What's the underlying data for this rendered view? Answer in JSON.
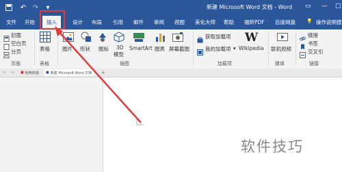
{
  "window": {
    "title": "新建 Microsoft Word 文档 - Word",
    "controls": {
      "minimize": "—",
      "maximize": "□",
      "close": "✕"
    }
  },
  "quick_access": {
    "save_icon": "save-icon",
    "undo_icon": "undo-icon",
    "redo_icon": "redo-icon"
  },
  "tabs": [
    {
      "label": "文件"
    },
    {
      "label": "开始"
    },
    {
      "label": "插入"
    },
    {
      "label": "设计"
    },
    {
      "label": "布局"
    },
    {
      "label": "引用"
    },
    {
      "label": "邮件"
    },
    {
      "label": "审阅"
    },
    {
      "label": "视图"
    },
    {
      "label": "美化大师"
    },
    {
      "label": "帮助"
    },
    {
      "label": "福昕PDF"
    },
    {
      "label": "百度网盘"
    },
    {
      "label": "操作说明搜"
    }
  ],
  "ribbon": {
    "pages": {
      "cover": "封面",
      "blank": "空白页",
      "break": "分页",
      "group": "页面"
    },
    "tables": {
      "table": "表格",
      "group": "表格"
    },
    "illustrations": {
      "pictures": "图片",
      "shapes": "形状",
      "icons": "图标",
      "model_3d_line1": "3D",
      "model_3d_line2": "模型",
      "smartart": "SmartArt",
      "chart": "图表",
      "screenshot": "屏幕截图",
      "group": "插图"
    },
    "addins": {
      "get": "获取加载项",
      "my": "我的加载项",
      "wikipedia": "Wikipedia",
      "group": "加载项"
    },
    "media": {
      "video": "联机视频",
      "group": "媒体"
    },
    "links": {
      "link": "链接",
      "bookmark": "书签",
      "crossref": "交叉引",
      "group": "链接"
    }
  },
  "doc_tabs": {
    "tab1": "稻壳商城",
    "tab2": "新建 Microsoft Word 文档",
    "new_tab": "+"
  },
  "watermark": "软件技巧",
  "colors": {
    "accent": "#2b579a",
    "highlight": "#e03a3a"
  }
}
